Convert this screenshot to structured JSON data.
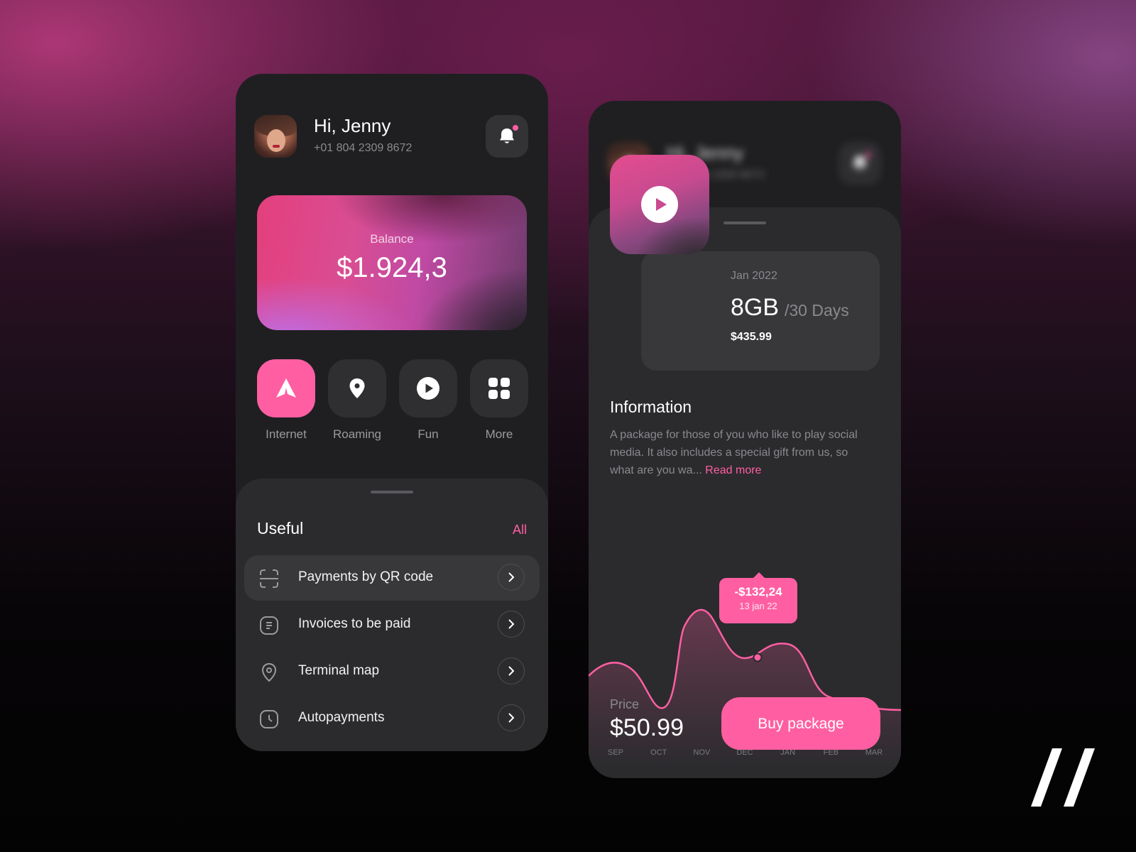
{
  "user": {
    "greeting": "Hi, Jenny",
    "phone": "+01 804 2309 8672"
  },
  "balance": {
    "label": "Balance",
    "value": "$1.924,3"
  },
  "quick_actions": [
    {
      "label": "Internet",
      "icon": "send-icon",
      "active": true
    },
    {
      "label": "Roaming",
      "icon": "location-pin-icon",
      "active": false
    },
    {
      "label": "Fun",
      "icon": "play-icon",
      "active": false
    },
    {
      "label": "More",
      "icon": "grid-icon",
      "active": false
    }
  ],
  "useful": {
    "title": "Useful",
    "all_label": "All",
    "items": [
      {
        "label": "Payments by QR code",
        "icon": "qr-scan-icon"
      },
      {
        "label": "Invoices to be paid",
        "icon": "invoice-icon"
      },
      {
        "label": "Terminal map",
        "icon": "map-pin-icon"
      },
      {
        "label": "Autopayments",
        "icon": "clock-icon"
      }
    ]
  },
  "package": {
    "date": "Jan 2022",
    "size": "8GB",
    "period": "/30 Days",
    "price": "$435.99"
  },
  "information": {
    "title": "Information",
    "text": "A package for those of you who like to play social media. It also includes a special gift from us, so what are you wa...",
    "read_more": "Read more"
  },
  "chart_data": {
    "type": "line",
    "categories": [
      "SEP",
      "OCT",
      "NOV",
      "DEC",
      "JAN",
      "FEB",
      "MAR"
    ],
    "tooltip": {
      "value": "-$132,24",
      "date": "13 jan 22"
    },
    "grid": false,
    "colors": {
      "line": "#ff5fa2"
    }
  },
  "purchase": {
    "price_label": "Price",
    "price_value": "$50.99",
    "buy_label": "Buy package"
  },
  "colors": {
    "accent": "#ff5fa2",
    "panel": "#1f1f21",
    "sheet": "#2b2b2e"
  }
}
